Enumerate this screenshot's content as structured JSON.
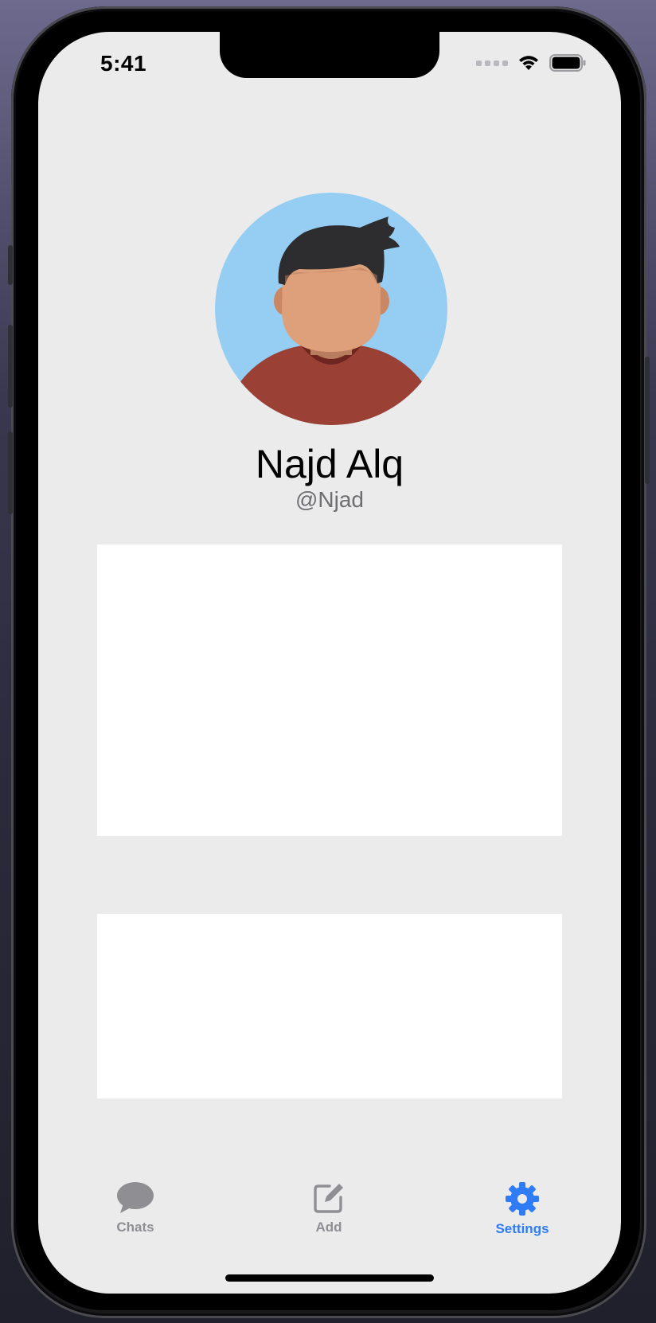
{
  "status_bar": {
    "time": "5:41",
    "icons": [
      "cellular-signal-icon",
      "wifi-icon",
      "battery-icon"
    ]
  },
  "profile": {
    "name": "Najd Alq",
    "handle": "@Njad",
    "avatar_icon": "person-avatar-icon"
  },
  "tabs": [
    {
      "label": "Chats",
      "icon": "chat-bubble-icon",
      "active": false
    },
    {
      "label": "Add",
      "icon": "compose-icon",
      "active": false
    },
    {
      "label": "Settings",
      "icon": "gear-icon",
      "active": true
    }
  ],
  "colors": {
    "screen_background": "#ebebec",
    "card_background": "#ffffff",
    "tab_active": "#2f7cf6",
    "tab_inactive": "#8e8e93",
    "avatar_background": "#96cdf3",
    "avatar_shirt": "#9b4034",
    "avatar_skin": "#dea07a",
    "avatar_hair": "#2d2d2f"
  }
}
